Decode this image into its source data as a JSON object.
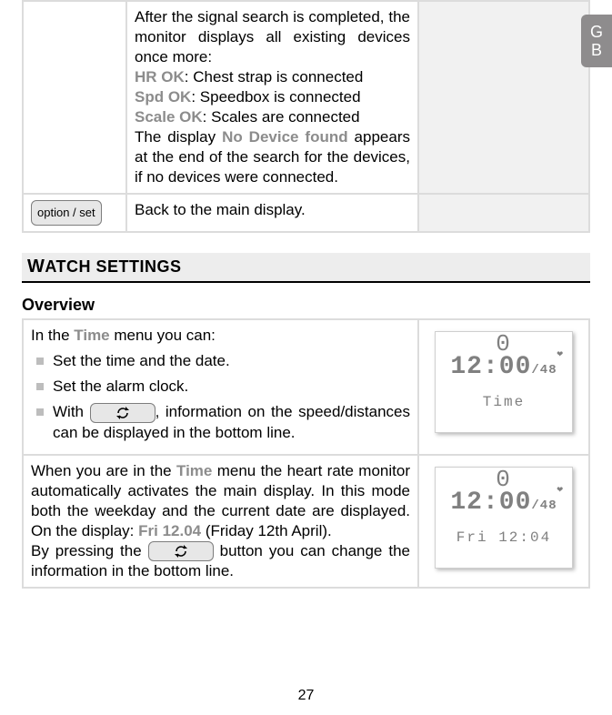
{
  "gb_tab": {
    "line1": "G",
    "line2": "B"
  },
  "device_table": {
    "row1": {
      "intro": "After the signal search is completed, the monitor displays all existing devices once more:",
      "hr_label": "HR OK",
      "hr_text": ": Chest strap is connected",
      "spd_label": "Spd OK",
      "spd_text": ": Speedbox is connected",
      "scale_label": "Scale OK",
      "scale_text": ": Scales are connected",
      "nodev_pre": "The display ",
      "nodev_label": "No Device found",
      "nodev_post": " appears at the end of the search for the devices, if no devices were con­nected."
    },
    "row2": {
      "button": "option / set",
      "text": "Back to the main display."
    }
  },
  "section_title_pre": "W",
  "section_title_rest": "ATCH SETTINGS",
  "overview_heading": "Overview",
  "overview_table": {
    "row1": {
      "intro_pre": "In the ",
      "intro_b": "Time",
      "intro_post": " menu you can:",
      "li1": "Set the time and the date.",
      "li2": "Set the alarm clock.",
      "li3_pre": "With ",
      "li3_post": ", information on the speed/dis­tances can be displayed in the bottom line.",
      "lcd": {
        "top": "0",
        "mid_main": "12:00",
        "mid_small": "/48",
        "bottom": "Time"
      }
    },
    "row2": {
      "p1_pre": "When you are in the ",
      "p1_b": "Time",
      "p1_mid": " menu the heart rate monitor automatically activates the main display. In this mode both the weekday and the current date are displayed. On the display: ",
      "p1_b2": "Fri 12.04",
      "p1_post": " (Friday 12th April).",
      "p2_pre": "By pressing the ",
      "p2_post": " button you can change the information in the bottom line.",
      "lcd": {
        "top": "0",
        "mid_main": "12:00",
        "mid_small": "/48",
        "bottom": "Fri  12:04"
      }
    }
  },
  "page_number": "27"
}
